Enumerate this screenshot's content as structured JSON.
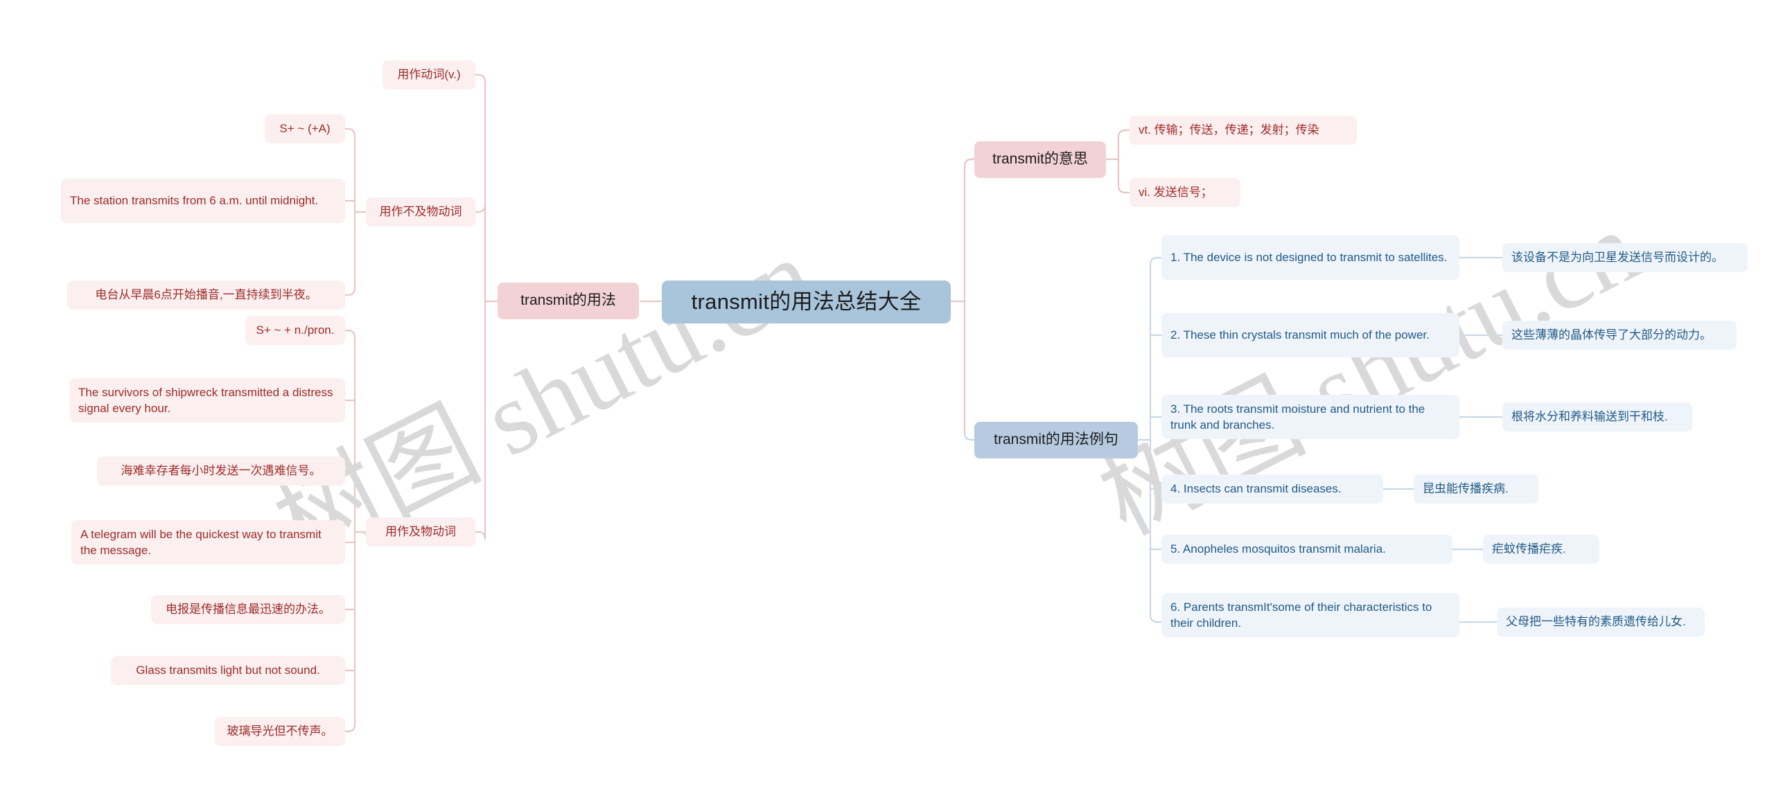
{
  "root": {
    "label": "transmit的用法总结大全",
    "color": "#a9c5dc"
  },
  "watermark": {
    "text_cn": "树图",
    "text_en": "shutu.cn",
    "full": "树图 shutu.cn",
    "color": "#d8d8d8"
  },
  "colors": {
    "pink_branch": "#f3d2d6",
    "blue_branch": "#b6cbdf",
    "red_leaf_bg": "#fbeff0",
    "red_text": "#9d2c28",
    "blue_leaf_bg": "#eef4fa",
    "blue_text": "#235a87",
    "red_link": "#e8c6c6",
    "blue_link": "#c8d8e6"
  },
  "left_branch": {
    "label": "transmit的用法",
    "children": [
      {
        "label": "用作动词(v.)"
      },
      {
        "label": "用作不及物动词",
        "pattern": "S+ ~ (+A)",
        "example_en": "The station transmits from 6 a.m. until midnight.",
        "example_cn": "电台从早晨6点开始播音,一直持续到半夜。"
      },
      {
        "label": "用作及物动词",
        "pattern": "S+ ~ + n./pron.",
        "examples": [
          {
            "en": "The survivors of shipwreck transmitted a distress signal every hour.",
            "cn": "海难幸存者每小时发送一次遇难信号。"
          },
          {
            "en": "A telegram will be the quickest way to transmit the message.",
            "cn": "电报是传播信息最迅速的办法。"
          },
          {
            "en": "Glass transmits light but not sound.",
            "cn": "玻璃导光但不传声。"
          }
        ]
      }
    ]
  },
  "right_branches": [
    {
      "label": "transmit的意思",
      "items": [
        "vt. 传输；传送，传递；发射；传染",
        "vi. 发送信号；"
      ]
    },
    {
      "label": "transmit的用法例句",
      "examples": [
        {
          "en": "1. The device is not designed to transmit to satellites.",
          "cn": "该设备不是为向卫星发送信号而设计的。"
        },
        {
          "en": "2. These thin crystals transmit much of the power.",
          "cn": "这些薄薄的晶体传导了大部分的动力。"
        },
        {
          "en": "3. The roots transmit moisture and nutrient to the trunk and branches.",
          "cn": "根将水分和养料输送到干和枝."
        },
        {
          "en": "4. Insects can transmit diseases.",
          "cn": "昆虫能传播疾病."
        },
        {
          "en": "5. Anopheles mosquitos transmit malaria.",
          "cn": "疟蚊传播疟疾."
        },
        {
          "en": "6. Parents transmIt'some of their characteristics to their children.",
          "cn": "父母把一些特有的素质遗传给儿女."
        }
      ]
    }
  ]
}
